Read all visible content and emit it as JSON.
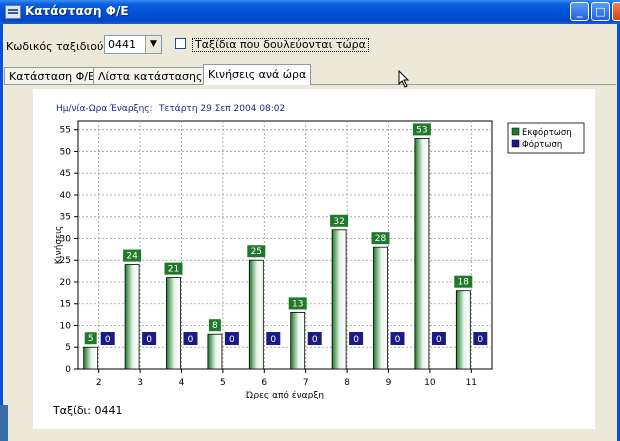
{
  "window": {
    "title": "Κατάσταση Φ/Ε"
  },
  "controls": {
    "trip_code_label": "Κωδικός ταξιδιού:",
    "trip_code_value": "0441",
    "active_trips_label": "Ταξίδια που δουλεύονται τώρα"
  },
  "tabs": [
    {
      "label": "Κατάσταση Φ/Ε"
    },
    {
      "label": "Λίστα κατάστασης ΕΚ"
    },
    {
      "label": "Κινήσεις ανά ώρα"
    }
  ],
  "panel": {
    "start_label": "Ημ/νία-Ωρα Έναρξης:",
    "start_value": "Τετάρτη 29 Σεπ 2004    08:02",
    "footer": "Ταξίδι: 0441"
  },
  "chart_data": {
    "type": "bar",
    "xlabel": "Ώρες από έναρξη",
    "ylabel": "Κινήσεις",
    "categories": [
      "2",
      "3",
      "4",
      "5",
      "6",
      "7",
      "8",
      "9",
      "10",
      "11"
    ],
    "series": [
      {
        "name": "Εκφόρτωση",
        "values": [
          5,
          24,
          21,
          8,
          25,
          13,
          32,
          28,
          53,
          18
        ],
        "color": "#1e7a2a"
      },
      {
        "name": "Φόρτωση",
        "values": [
          0,
          0,
          0,
          0,
          0,
          0,
          0,
          0,
          0,
          0
        ],
        "color": "#1a1a8a"
      }
    ],
    "ylim": [
      0,
      57
    ],
    "yticks": [
      0,
      5,
      10,
      15,
      20,
      25,
      30,
      35,
      40,
      45,
      50,
      55
    ],
    "grid": true,
    "legend": "top-right"
  }
}
